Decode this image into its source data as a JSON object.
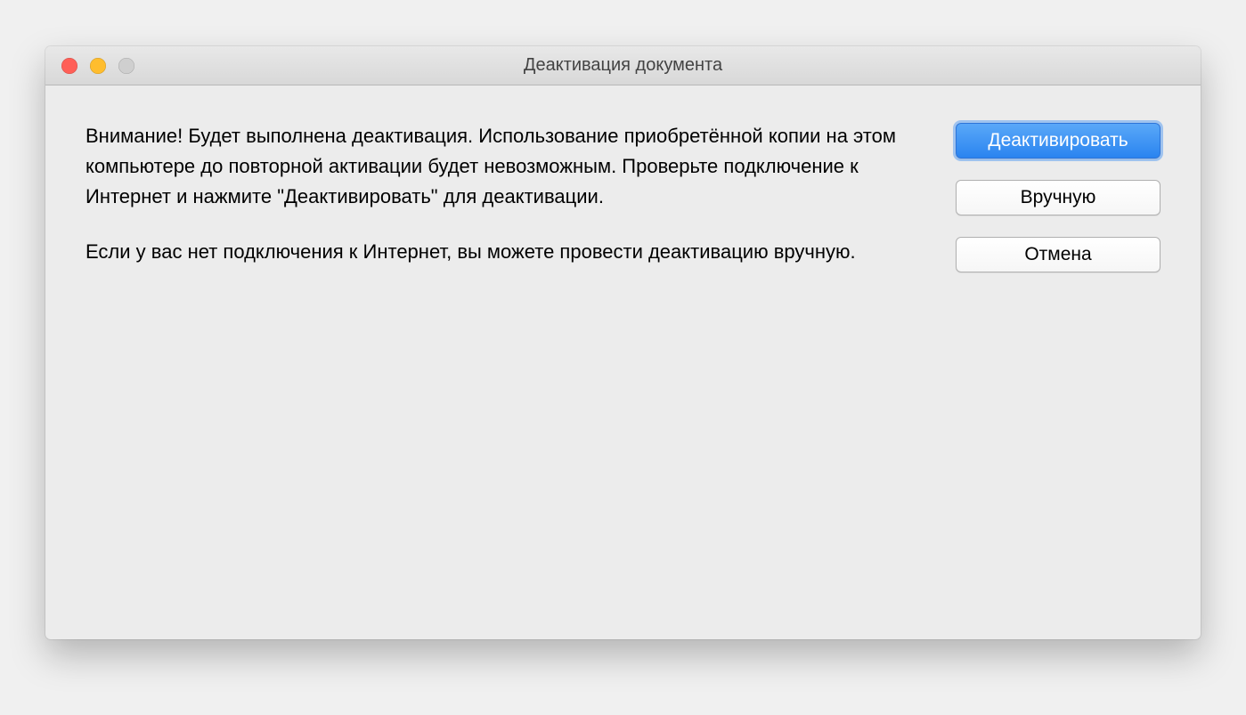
{
  "window": {
    "title": "Деактивация документа"
  },
  "message": {
    "paragraph1": "Внимание! Будет выполнена деактивация. Использование приобретённой копии на этом компьютере до повторной активации будет невозможным. Проверьте подключение к Интернет и нажмите \"Деактивировать\" для деактивации.",
    "paragraph2": "Если у вас нет подключения к Интернет, вы можете провести деактивацию вручную."
  },
  "buttons": {
    "deactivate": "Деактивировать",
    "manual": "Вручную",
    "cancel": "Отмена"
  }
}
